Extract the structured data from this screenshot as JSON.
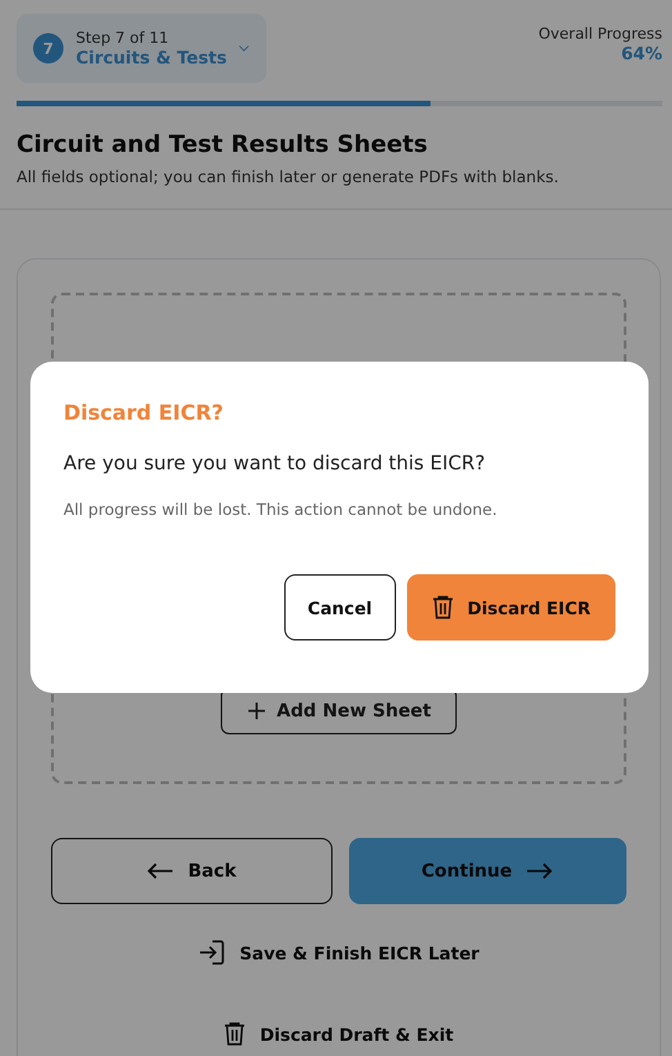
{
  "header": {
    "step_number": "7",
    "step_label": "Step 7 of 11",
    "step_title": "Circuits & Tests",
    "progress_label": "Overall Progress",
    "progress_value": "64%",
    "level": 0.64
  },
  "page": {
    "title": "Circuit and Test Results Sheets",
    "subtitle": "All fields optional; you can finish later or generate PDFs with blanks."
  },
  "sheets": {
    "add_button": "Add New Sheet"
  },
  "navigation": {
    "back": "Back",
    "continue": "Continue",
    "save_later": "Save & Finish EICR Later",
    "discard_draft": "Discard Draft & Exit"
  },
  "dialog": {
    "title": "Discard EICR?",
    "message": "Are you sure you want to discard this EICR?",
    "note": "All progress will be lost. This action cannot be undone.",
    "cancel": "Cancel",
    "confirm": "Discard EICR"
  }
}
